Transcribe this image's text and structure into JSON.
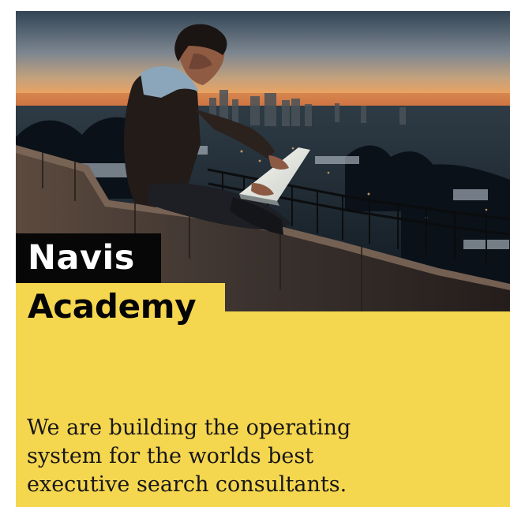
{
  "brand": {
    "name_line_1": "Navis",
    "name_line_2": "Academy"
  },
  "hero": {
    "image_alt": "Person using a laptop on a rooftop at sunset over a city"
  },
  "tagline": {
    "line_1": "We are building the operating",
    "line_2": "system for the worlds best",
    "line_3": "executive  search consultants."
  },
  "colors": {
    "accent_yellow": "#f5d64f",
    "brand_black": "#070707",
    "text_dark": "#171717",
    "sky_orange": "#f0a45a",
    "city_blue": "#17202a"
  }
}
